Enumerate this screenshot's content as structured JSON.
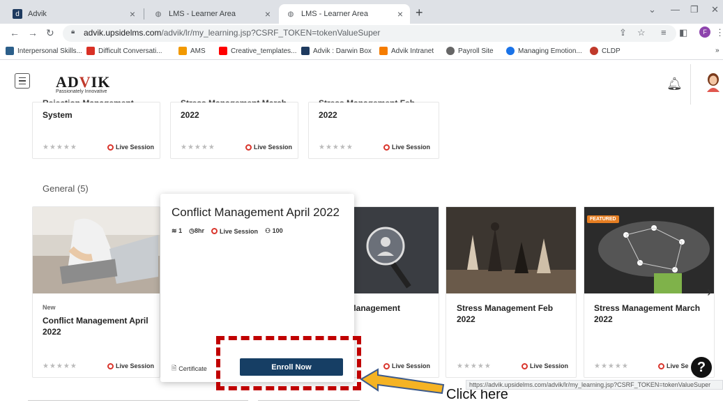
{
  "browser": {
    "tabs": [
      {
        "title": "Advik"
      },
      {
        "title": "LMS - Learner Area"
      },
      {
        "title": "LMS - Learner Area"
      }
    ],
    "url_host": "advik.upsidelms.com",
    "url_path": "/advik/lr/my_learning.jsp?CSRF_TOKEN=tokenValueSuper",
    "profile_initial": "F",
    "bookmarks": [
      "Interpersonal Skills...",
      "Difficult Conversati...",
      "AMS",
      "Creative_templates...",
      "Advik : Darwin Box",
      "Advik Intranet",
      "Payroll Site",
      "Managing Emotion...",
      "CLDP"
    ],
    "bookmark_overflow": "»",
    "status_url": "https://advik.upsidelms.com/advik/lr/my_learning.jsp?CSRF_TOKEN=tokenValueSuper"
  },
  "header": {
    "logo_pre": "AD",
    "logo_mid": "V",
    "logo_post": "IK",
    "tagline": "Passionately Innovative"
  },
  "top_row": [
    {
      "title_cut": "Rejection Management",
      "title": "System",
      "live": "Live Session"
    },
    {
      "title_cut": "Stress Management March",
      "title": "2022",
      "live": "Live Session"
    },
    {
      "title_cut": "Stress Management Feb",
      "title": "2022",
      "live": "Live Session"
    }
  ],
  "section": {
    "title": "General (5)"
  },
  "general_cards": [
    {
      "badge": "New",
      "title": "Conflict Management April 2022",
      "live": "Live Session"
    },
    {
      "title": "n Management",
      "live": "Live Session"
    },
    {
      "title": "Stress Management Feb 2022",
      "live": "Live Session"
    },
    {
      "featured": "FEATURED",
      "title": "Stress Management March 2022",
      "live": "Live Se"
    }
  ],
  "hover_card": {
    "title": "Conflict Management April 2022",
    "modules": "1",
    "duration": "8hr",
    "type": "Live Session",
    "enrolled": "100",
    "certificate": "Certificate",
    "enroll_label": "Enroll Now"
  },
  "annotation": {
    "text": "Click here"
  },
  "stars": "★★★★★",
  "help": "?"
}
